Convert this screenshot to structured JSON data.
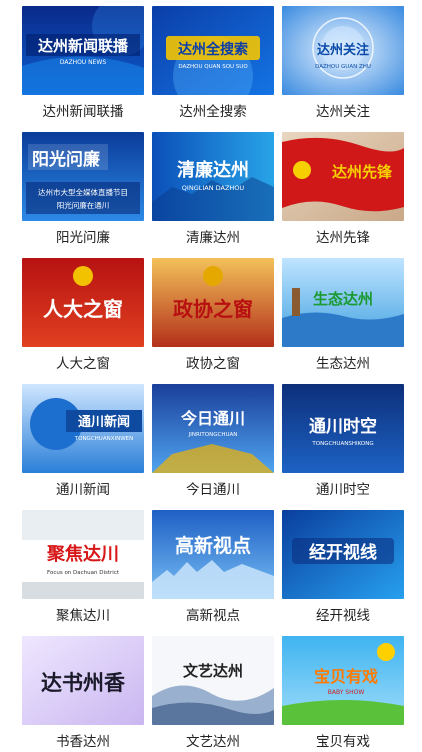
{
  "programs": [
    {
      "label": "达州新闻联播",
      "logo_text": "达州新闻联播",
      "logo_sub": "DAZHOU NEWS"
    },
    {
      "label": "达州全搜索",
      "logo_text": "达州全搜索",
      "logo_sub": "DAZHOU QUAN SOU SUO"
    },
    {
      "label": "达州关注",
      "logo_text": "达州关注",
      "logo_sub": "DAZHOU GUAN ZHU"
    },
    {
      "label": "阳光问廉",
      "logo_text": "阳光问廉",
      "logo_sub": "达州市大型全媒体直播节目",
      "logo_sub2": "阳光问廉在通川"
    },
    {
      "label": "清廉达州",
      "logo_text": "清廉达州",
      "logo_sub": "QINGLIAN DAZHOU"
    },
    {
      "label": "达州先锋",
      "logo_text": "达州先锋"
    },
    {
      "label": "人大之窗",
      "logo_text": "人大之窗"
    },
    {
      "label": "政协之窗",
      "logo_text": "政协之窗"
    },
    {
      "label": "生态达州",
      "logo_text": "生态达州"
    },
    {
      "label": "通川新闻",
      "logo_text": "通川新闻",
      "logo_sub": "TONGCHUANXINWEN"
    },
    {
      "label": "今日通川",
      "logo_text": "今日通川",
      "logo_sub": "JINRITONGCHUAN"
    },
    {
      "label": "通川时空",
      "logo_text": "通川时空",
      "logo_sub": "TONGCHUANSHIKONG"
    },
    {
      "label": "聚焦达川",
      "logo_text": "聚焦达川",
      "logo_sub": "Focus on Dachuan District"
    },
    {
      "label": "高新视点",
      "logo_text": "高新视点"
    },
    {
      "label": "经开视线",
      "logo_text": "经开视线"
    },
    {
      "label": "书香达州",
      "logo_text": "达书州香"
    },
    {
      "label": "文艺达州",
      "logo_text": "文艺达州"
    },
    {
      "label": "宝贝有戏",
      "logo_text": "宝贝有戏",
      "logo_sub": "BABY SHOW"
    }
  ]
}
